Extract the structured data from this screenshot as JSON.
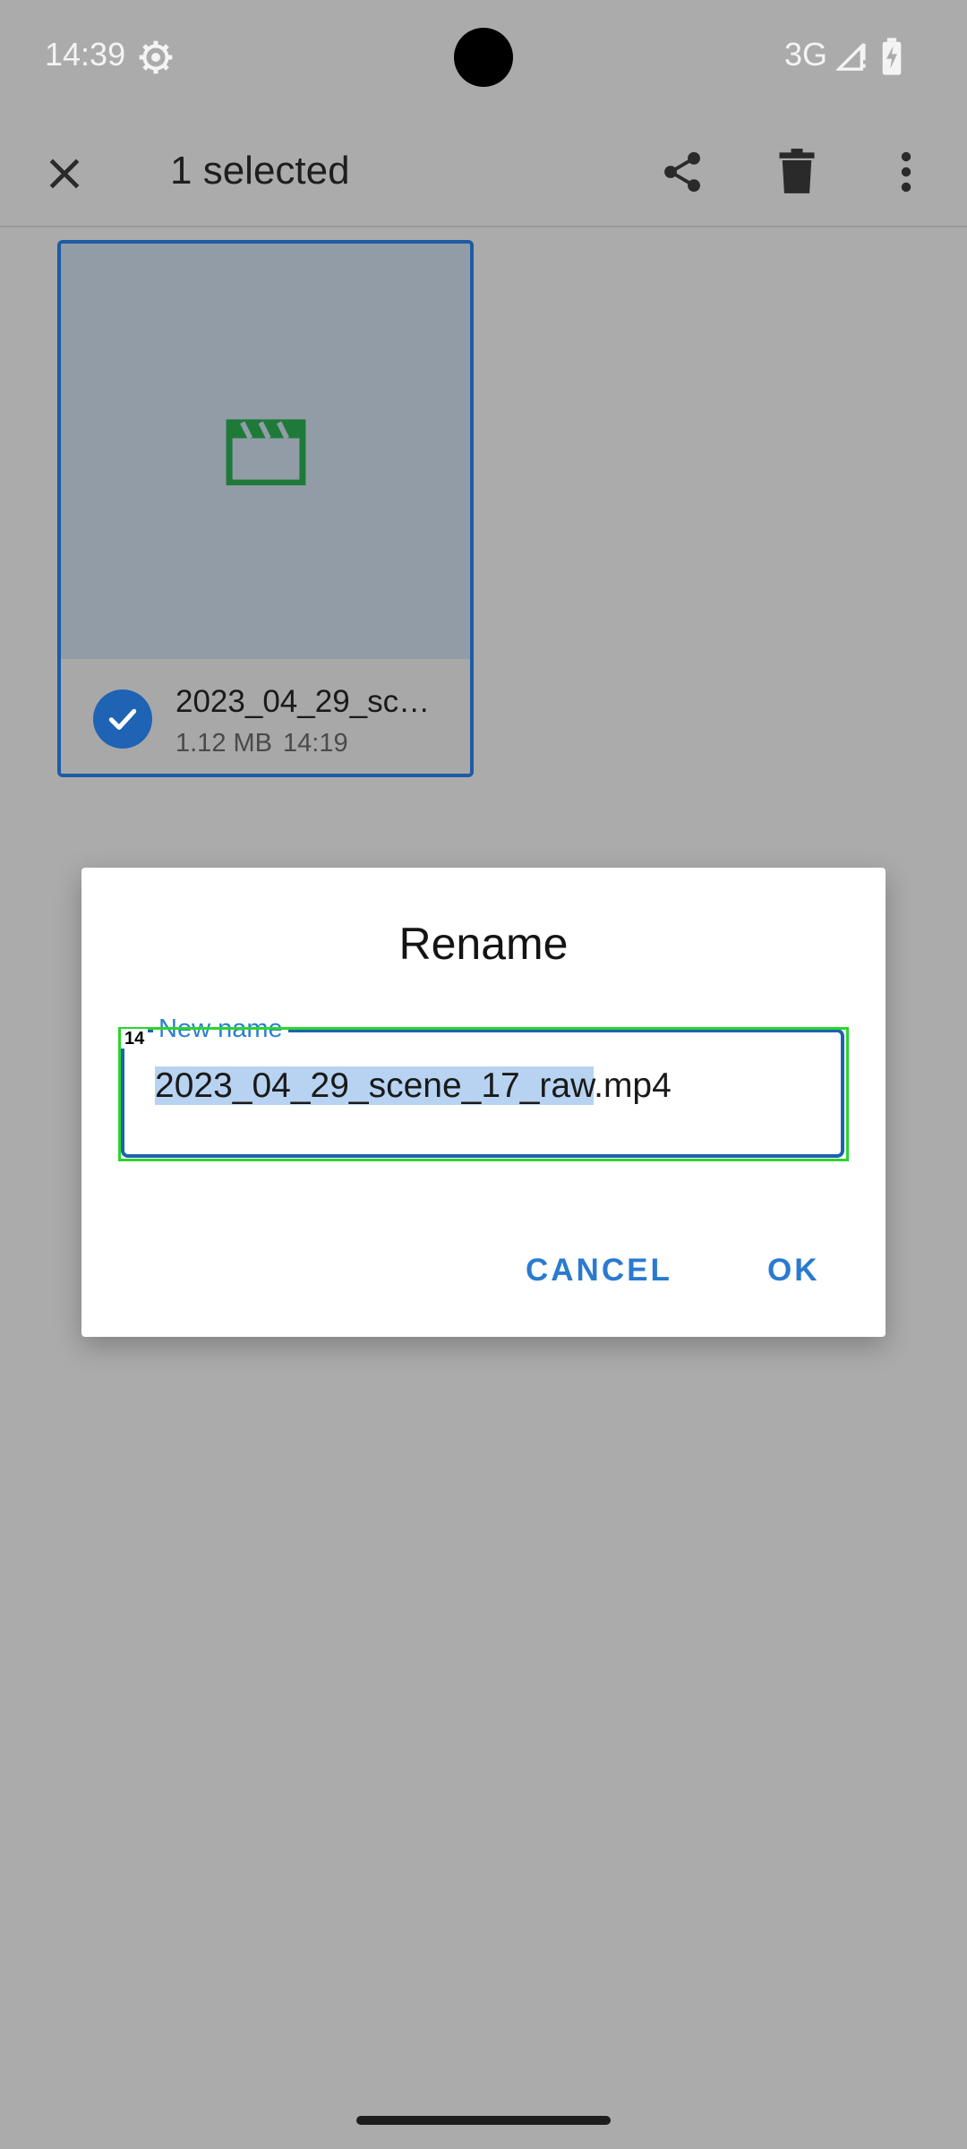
{
  "status_bar": {
    "time": "14:39",
    "network": "3G",
    "icons": [
      "settings-gear-icon",
      "signal-icon",
      "battery-charging-icon"
    ]
  },
  "app_bar": {
    "title": "1 selected",
    "actions": [
      "close-icon",
      "share-icon",
      "delete-icon",
      "more-vert-icon"
    ]
  },
  "file": {
    "name": "2023_04_29_sc…",
    "size": "1.12 MB",
    "time": "14:19",
    "selected": true,
    "thumbnail_icon": "movie-clapper-icon"
  },
  "dialog": {
    "title": "Rename",
    "field_label": "New name",
    "value_selected": "2023_04_29_scene_17_raw",
    "value_rest": ".mp4",
    "highlight_tag": "14",
    "cancel_label": "CANCEL",
    "ok_label": "OK"
  },
  "colors": {
    "scrim": "#ababab",
    "accent": "#2a7ad0",
    "selection_border": "#1d5ca6",
    "clapper_green": "#1f7a3a",
    "highlight_green": "#2bd62b"
  }
}
